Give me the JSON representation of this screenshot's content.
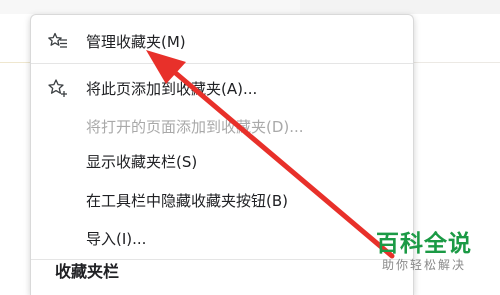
{
  "menu": {
    "items": [
      {
        "label": "管理收藏夹(M)",
        "icon": "star-list-icon",
        "enabled": true
      },
      {
        "label": "将此页添加到收藏夹(A)...",
        "icon": "star-add-icon",
        "enabled": true
      },
      {
        "label": "将打开的页面添加到收藏夹(D)...",
        "icon": "",
        "enabled": false
      },
      {
        "label": "显示收藏夹栏(S)",
        "icon": "",
        "enabled": true
      },
      {
        "label": "在工具栏中隐藏收藏夹按钮(B)",
        "icon": "",
        "enabled": true
      },
      {
        "label": "导入(I)...",
        "icon": "",
        "enabled": true
      }
    ],
    "section_title": "收藏夹栏"
  },
  "watermark": {
    "title": "百科全说",
    "subtitle": "助你轻松解决"
  },
  "colors": {
    "arrow": "#e8302a",
    "watermark_green": "#1b9a45",
    "disabled_text": "#a9a9a9"
  }
}
